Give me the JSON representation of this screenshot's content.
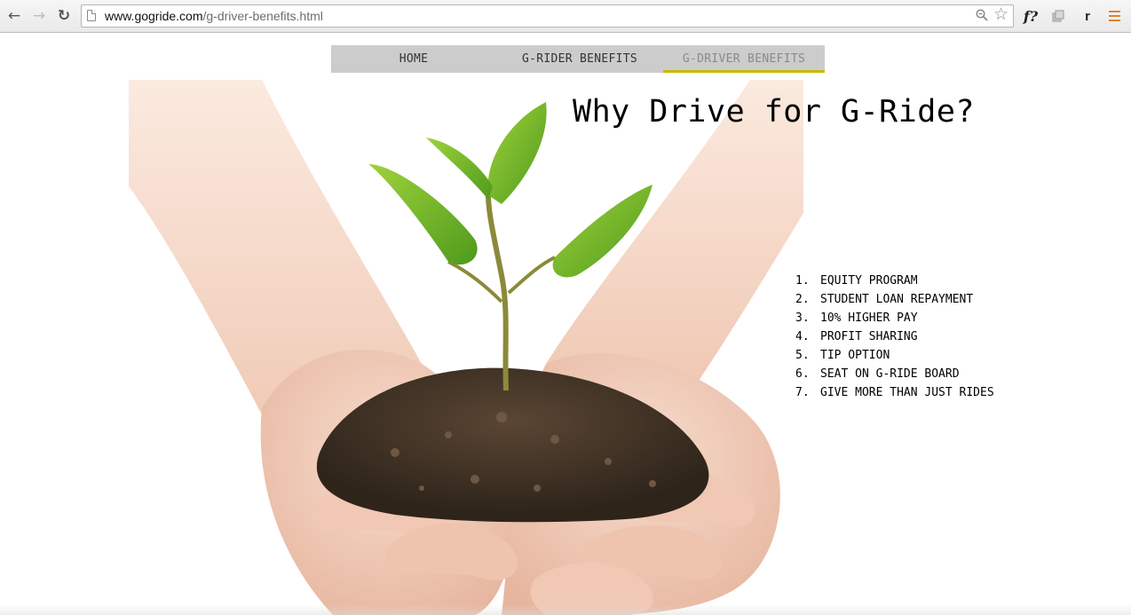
{
  "browser": {
    "url_domain": "www.gogride.com",
    "url_path": "/g-driver-benefits.html",
    "back_glyph": "←",
    "forward_glyph": "→",
    "reload_glyph": "↻",
    "star_glyph": "☆",
    "ext_f_label": "f?",
    "ext_r_label": "r",
    "menu_color": "#e0852b"
  },
  "nav": {
    "tabs": [
      {
        "label": "HOME"
      },
      {
        "label": "G-RIDER BENEFITS"
      },
      {
        "label": "G-DRIVER BENEFITS",
        "active": true
      }
    ],
    "active_underline_color": "#c9b800"
  },
  "main": {
    "headline": "Why Drive for G-Ride?",
    "benefits": [
      {
        "num": "1.",
        "text": "EQUITY PROGRAM"
      },
      {
        "num": "2.",
        "text": "STUDENT LOAN REPAYMENT"
      },
      {
        "num": "3.",
        "text": "10% HIGHER PAY"
      },
      {
        "num": "4.",
        "text": "PROFIT SHARING"
      },
      {
        "num": "5.",
        "text": "TIP OPTION"
      },
      {
        "num": "6.",
        "text": "SEAT ON G-RIDE BOARD"
      },
      {
        "num": "7.",
        "text": "GIVE MORE THAN JUST RIDES"
      }
    ]
  }
}
